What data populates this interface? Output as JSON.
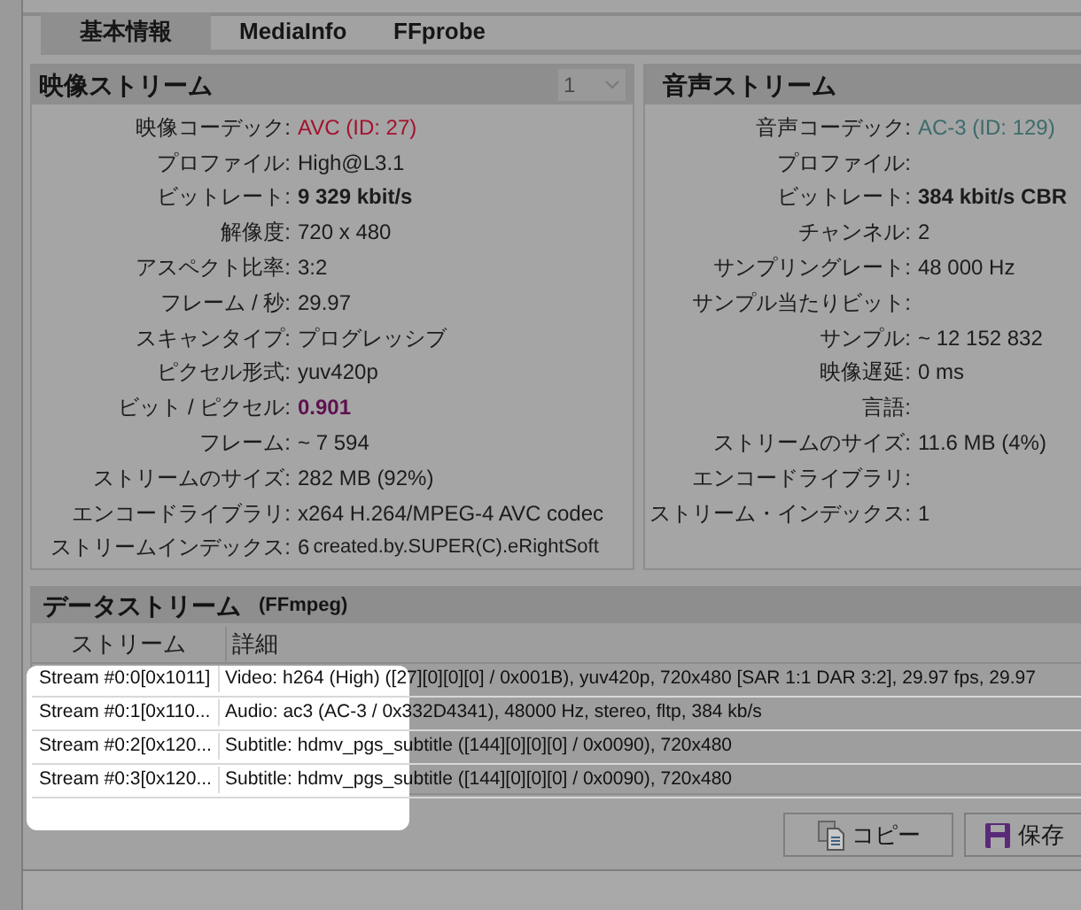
{
  "tabs": [
    {
      "label": "基本情報",
      "selected": true
    },
    {
      "label": "MediaInfo",
      "selected": false
    },
    {
      "label": "FFprobe",
      "selected": false
    }
  ],
  "video": {
    "title": "映像ストリーム",
    "selector": "1",
    "rows": [
      {
        "label": "映像コーデック:",
        "value": "AVC (ID: 27)",
        "kind": "red"
      },
      {
        "label": "プロファイル:",
        "value": "High@L3.1",
        "kind": "normal"
      },
      {
        "label": "ビットレート:",
        "value": "9 329 kbit/s",
        "kind": "bold"
      },
      {
        "label": "解像度:",
        "value": "720 x 480",
        "kind": "normal"
      },
      {
        "label": "アスペクト比率:",
        "value": "3:2",
        "kind": "normal"
      },
      {
        "label": "フレーム / 秒:",
        "value": "29.97",
        "kind": "normal"
      },
      {
        "label": "スキャンタイプ:",
        "value": "プログレッシブ",
        "kind": "normal"
      },
      {
        "label": "ピクセル形式:",
        "value": "yuv420p",
        "kind": "normal"
      },
      {
        "label": "ビット / ピクセル:",
        "value": "0.901",
        "kind": "purple"
      },
      {
        "label": "フレーム:",
        "value": "~ 7 594",
        "kind": "normal"
      },
      {
        "label": "ストリームのサイズ:",
        "value": "282 MB (92%)",
        "kind": "normal"
      },
      {
        "label": "エンコードライブラリ:",
        "value": "x264 H.264/MPEG-4 AVC codec",
        "kind": "normal"
      },
      {
        "label": "ストリームインデックス:",
        "value": "6",
        "kind": "normal",
        "note": "created.by.SUPER(C).eRightSoft"
      }
    ]
  },
  "audio": {
    "title": "音声ストリーム",
    "rows": [
      {
        "label": "音声コーデック:",
        "value": "AC-3 (ID: 129)",
        "kind": "teal"
      },
      {
        "label": "プロファイル:"
      },
      {
        "label": "ビットレート:",
        "value": "384 kbit/s  CBR",
        "kind": "bold"
      },
      {
        "label": "チャンネル:",
        "value": "2",
        "kind": "normal"
      },
      {
        "label": "サンプリングレート:",
        "value": "48 000 Hz",
        "kind": "normal"
      },
      {
        "label": "サンプル当たりビット:"
      },
      {
        "label": "サンプル:",
        "value": "~ 12 152 832",
        "kind": "normal"
      },
      {
        "label": "映像遅延:",
        "value": "0 ms",
        "kind": "normal"
      },
      {
        "label": "言語:"
      },
      {
        "label": "ストリームのサイズ:",
        "value": "11.6 MB (4%)",
        "kind": "normal"
      },
      {
        "label": "エンコードライブラリ:"
      },
      {
        "label": "ストリーム・インデックス:",
        "value": "1",
        "kind": "normal"
      }
    ]
  },
  "data_stream": {
    "title": "データストリーム",
    "subtitle": "(FFmpeg)",
    "columns": [
      "ストリーム",
      "詳細"
    ],
    "rows": [
      [
        "Stream #0:0[0x1011]",
        "Video: h264 (High) ([27][0][0][0] / 0x001B), yuv420p, 720x480 [SAR 1:1 DAR 3:2], 29.97 fps, 29.97"
      ],
      [
        "Stream #0:1[0x110...",
        "Audio: ac3 (AC-3 / 0x332D4341), 48000 Hz, stereo, fltp, 384 kb/s"
      ],
      [
        "Stream #0:2[0x120...",
        "Subtitle: hdmv_pgs_subtitle ([144][0][0][0] / 0x0090), 720x480"
      ],
      [
        "Stream #0:3[0x120...",
        "Subtitle: hdmv_pgs_subtitle ([144][0][0][0] / 0x0090), 720x480"
      ]
    ]
  },
  "buttons": [
    {
      "label": "コピー",
      "kind": "copy"
    },
    {
      "label": "保存",
      "kind": "save"
    }
  ]
}
